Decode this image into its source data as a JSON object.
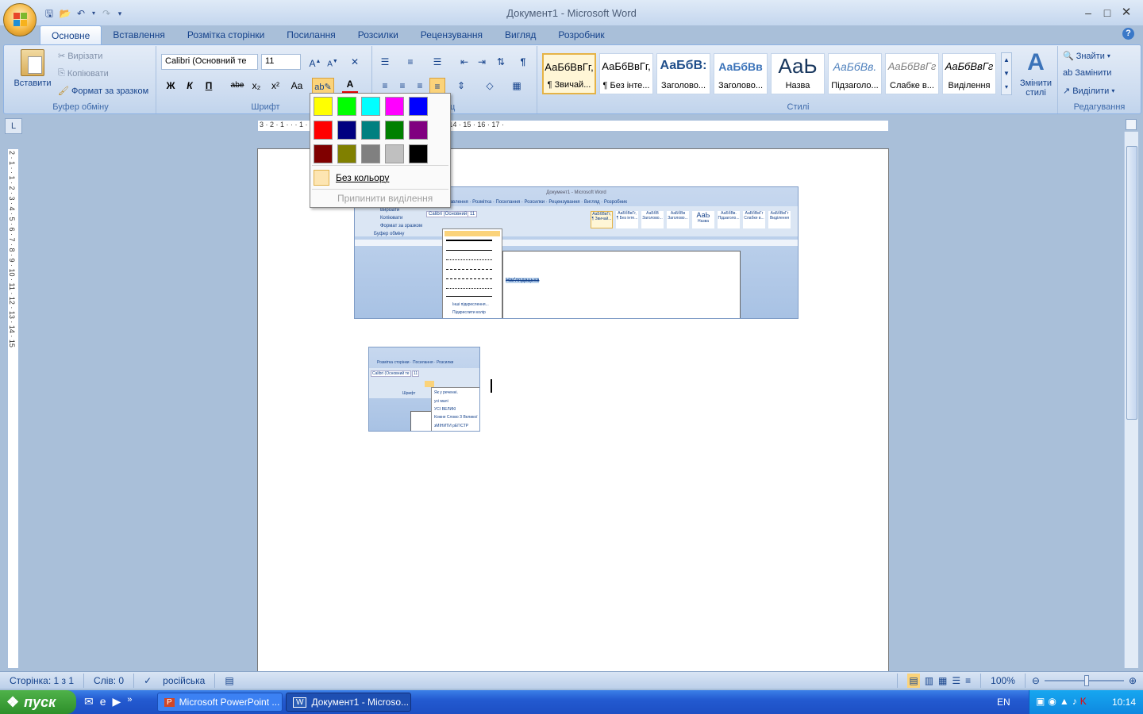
{
  "window": {
    "title": "Документ1 - Microsoft Word"
  },
  "tabs": [
    "Основне",
    "Вставлення",
    "Розмітка сторінки",
    "Посилання",
    "Розсилки",
    "Рецензування",
    "Вигляд",
    "Розробник"
  ],
  "clipboard": {
    "paste": "Вставити",
    "cut": "Вирізати",
    "copy": "Копіювати",
    "format_painter": "Формат за зразком",
    "group": "Буфер обміну"
  },
  "font": {
    "name": "Calibri (Основний те",
    "size": "11",
    "group": "Шрифт",
    "bold": "Ж",
    "italic": "К",
    "underline": "П",
    "strike": "abe",
    "sub": "x₂",
    "sup": "x²",
    "case": "Aa"
  },
  "paragraph": {
    "group": "Абзац",
    "group_visible": "ц"
  },
  "styles": {
    "group": "Стилі",
    "items": [
      {
        "preview": "АаБбВвГг,",
        "name": "¶ Звичай..."
      },
      {
        "preview": "АаБбВвГг,",
        "name": "¶ Без інте..."
      },
      {
        "preview": "АаБбВ:",
        "name": "Заголово..."
      },
      {
        "preview": "АаБбВв",
        "name": "Заголово..."
      },
      {
        "preview": "АаЬ",
        "name": "Назва"
      },
      {
        "preview": "АаБбВв.",
        "name": "Підзаголо..."
      },
      {
        "preview": "АаБбВвГг",
        "name": "Слабке в..."
      },
      {
        "preview": "АаБбВвГг",
        "name": "Виділення"
      }
    ],
    "change": "Змінити стилі"
  },
  "editing": {
    "group": "Редагування",
    "find": "Знайти",
    "replace": "Замінити",
    "select": "Виділити"
  },
  "highlight_popup": {
    "colors": [
      "#ffff00",
      "#00ff00",
      "#00ffff",
      "#ff00ff",
      "#0000ff",
      "#ff0000",
      "#000080",
      "#008080",
      "#008000",
      "#800080",
      "#800000",
      "#808000",
      "#808080",
      "#c0c0c0",
      "#000000"
    ],
    "no_color": "Без кольору",
    "stop": "Припинити виділення"
  },
  "ruler": {
    "h": "3 · 2 · 1 · · · 1 · 2 · 3 · 4 · 5 · 6 · 7 · 8 · 9 · 10 · 11 · 12 · 13 · 14 · 15 · 16 · 17 ·",
    "v": "2 · 1 · · 1 · 2 · 3 · 4 · 5 · 6 · 7 · 8 · 9 · 10 · 11 · 12 · 13 · 14 · 15"
  },
  "embedded1": {
    "title": "Документ1 - Microsoft Word",
    "tabs": "Вставлення · Розмітка · Посилання · Розсилки · Рецензування · Вигляд · Розробник",
    "items": [
      "Вирізати",
      "Копіювати",
      "Формат за зразком",
      "Буфер обміну"
    ],
    "font": "Calibri (Основний те",
    "size": "11",
    "menu": [
      "Інші підкреслення...",
      "Підкреслити колір"
    ],
    "highlighted_text": "Наґлядацька",
    "styles": [
      "АаБбВвГг,",
      "АаБбВвГг,",
      "АаБбВ",
      "АаБбВв",
      "АаЬ",
      "АаБбВв.",
      "АаБбВвГг",
      "АаБбВвГг"
    ],
    "style_names": [
      "¶ Звичай...",
      "¶ Без інте...",
      "Заголово...",
      "Заголово...",
      "Назва",
      "Підзаголо...",
      "Слабке в...",
      "Виділення"
    ]
  },
  "embedded2": {
    "tabs": "Розмітка сторінки · Посилання · Розсилки",
    "font": "Calibri (Основний те",
    "size": "11",
    "group": "Шрифт",
    "menu": [
      "Як у реченні.",
      "усі малі",
      "УСІ ВЕЛИКІ",
      "Кожне Слово З Великої",
      "зМІНИТИ рЕГІСТР"
    ]
  },
  "status": {
    "page": "Сторінка: 1 з 1",
    "words": "Слів: 0",
    "language": "російська",
    "zoom": "100%"
  },
  "taskbar": {
    "start": "пуск",
    "tasks": [
      "Microsoft PowerPoint ...",
      "Документ1 - Microso..."
    ],
    "lang": "EN",
    "clock": "10:14"
  }
}
